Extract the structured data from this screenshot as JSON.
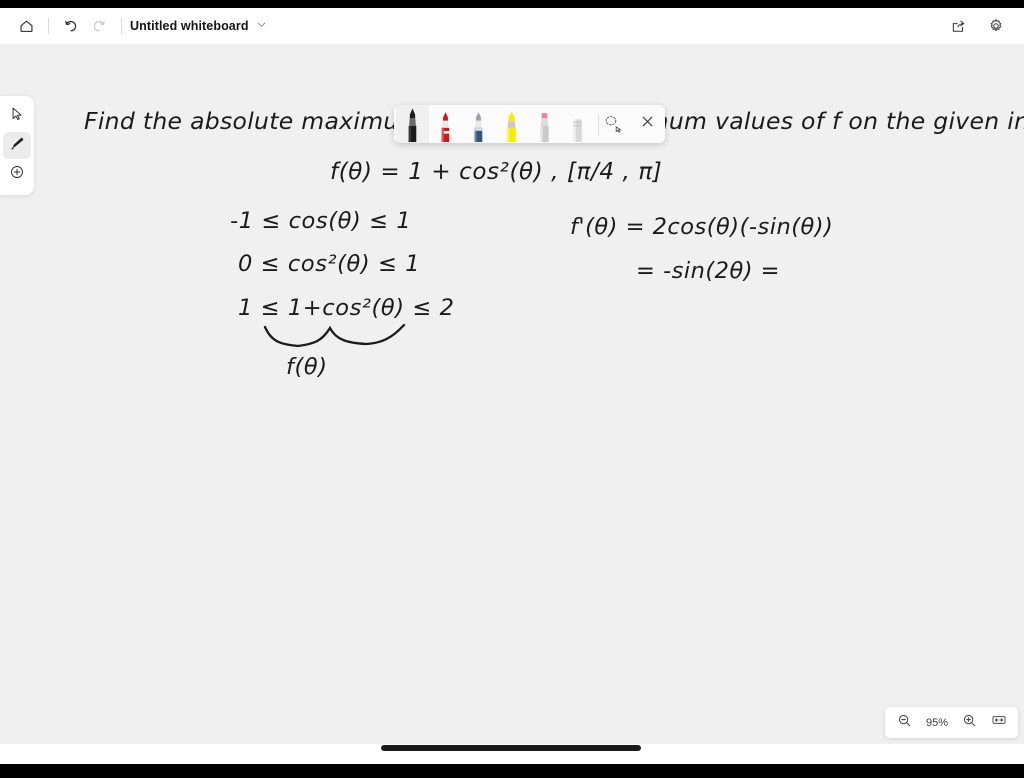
{
  "window": {
    "app_kind": "whiteboard",
    "title": "Untitled whiteboard"
  },
  "topbar": {
    "home_label": "Home",
    "undo_label": "Undo",
    "redo_label": "Redo",
    "title": "Untitled whiteboard",
    "title_menu_label": "Whiteboard options",
    "share_label": "Share",
    "settings_label": "Settings"
  },
  "left_rail": {
    "items": [
      {
        "icon": "cursor-select-icon",
        "label": "Select",
        "active": false
      },
      {
        "icon": "pen-icon",
        "label": "Pen",
        "active": true
      },
      {
        "icon": "plus-circle-icon",
        "label": "Insert",
        "active": false
      }
    ]
  },
  "pen_toolbar": {
    "pens": [
      {
        "name": "black-pen",
        "label": "Black pen",
        "color": "#1d1d1d",
        "selected": true
      },
      {
        "name": "red-pen",
        "label": "Red pen",
        "color": "#d01a1a",
        "selected": false
      },
      {
        "name": "blue-pen",
        "label": "Blue pen",
        "color": "#33567f",
        "selected": false
      },
      {
        "name": "yellow-highlighter",
        "label": "Yellow highlighter",
        "color": "#f5ec00",
        "selected": false
      },
      {
        "name": "pink-highlighter",
        "label": "Pink highlighter",
        "color": "#ef7fa8",
        "selected": false
      },
      {
        "name": "eraser",
        "label": "Eraser",
        "color": "#d9d9d9",
        "selected": false
      }
    ],
    "lasso_label": "Lasso select",
    "close_label": "Close"
  },
  "zoom_controls": {
    "zoom_out_label": "Zoom out",
    "level": "95%",
    "zoom_in_label": "Zoom in",
    "fit_label": "Fit to screen"
  },
  "canvas": {
    "background_color": "#f0f0f0",
    "ink_color": "#1b1b1b",
    "notes": {
      "prompt": "Find the absolute maximum and absolute minimum values of f on the given interval.",
      "function_line": "f(θ) = 1 + cos²(θ) ,  [π/4 , π]",
      "left_work": [
        "-1 ≤ cos(θ) ≤ 1",
        "0 ≤ cos²(θ) ≤ 1",
        "1 ≤ 1+cos²(θ) ≤ 2"
      ],
      "underbrace_label": "f(θ)",
      "right_work": [
        "f'(θ) = 2cos(θ)(-sin(θ))",
        "= -sin(2θ) ="
      ]
    }
  },
  "scrollbar": {
    "horizontal_label": "Horizontal scrollbar"
  }
}
